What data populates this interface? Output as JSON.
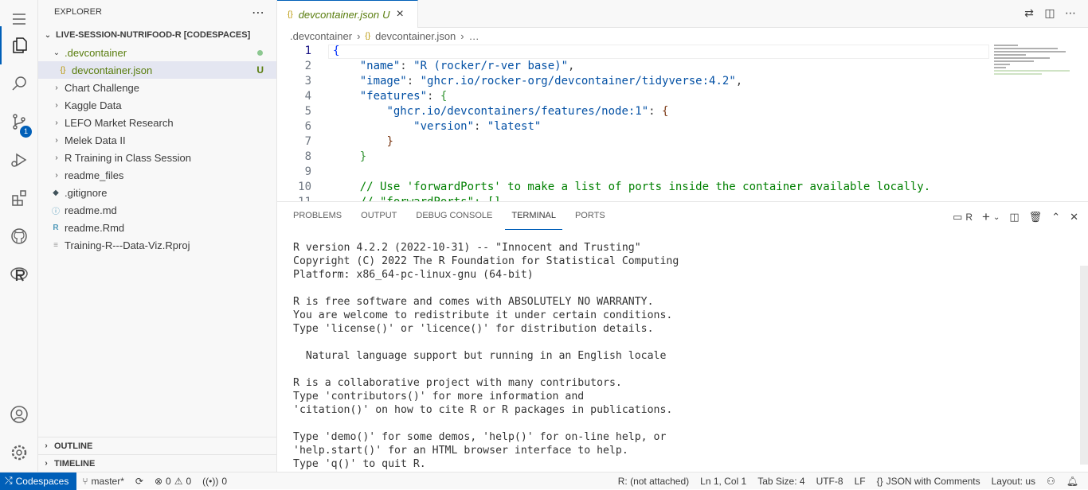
{
  "activity": {
    "scm_badge": "1"
  },
  "sidebar": {
    "title": "EXPLORER",
    "root": "LIVE-SESSION-NUTRIFOOD-R [CODESPACES]",
    "items": [
      {
        "label": ".devcontainer",
        "type": "folder-open",
        "color": "green"
      },
      {
        "label": "devcontainer.json",
        "type": "json",
        "decoration": "U"
      },
      {
        "label": "Chart Challenge",
        "type": "folder"
      },
      {
        "label": "Kaggle Data",
        "type": "folder"
      },
      {
        "label": "LEFO Market Research",
        "type": "folder"
      },
      {
        "label": "Melek Data II",
        "type": "folder"
      },
      {
        "label": "R Training in Class Session",
        "type": "folder"
      },
      {
        "label": "readme_files",
        "type": "folder"
      },
      {
        "label": ".gitignore",
        "type": "file"
      },
      {
        "label": "readme.md",
        "type": "file"
      },
      {
        "label": "readme.Rmd",
        "type": "file"
      },
      {
        "label": "Training-R---Data-Viz.Rproj",
        "type": "file"
      }
    ],
    "outline": "OUTLINE",
    "timeline": "TIMELINE"
  },
  "editor": {
    "tab_label": "devcontainer.json",
    "tab_decoration": "U",
    "breadcrumb": [
      ".devcontainer",
      "devcontainer.json",
      "…"
    ],
    "line_numbers": [
      "1",
      "2",
      "3",
      "4",
      "5",
      "6",
      "7",
      "8",
      "9",
      "10",
      "11"
    ]
  },
  "panel": {
    "tabs": [
      "PROBLEMS",
      "OUTPUT",
      "DEBUG CONSOLE",
      "TERMINAL",
      "PORTS"
    ],
    "active_tab": "TERMINAL",
    "terminal_name": "R",
    "terminal_lines": [
      "R version 4.2.2 (2022-10-31) -- \"Innocent and Trusting\"",
      "Copyright (C) 2022 The R Foundation for Statistical Computing",
      "Platform: x86_64-pc-linux-gnu (64-bit)",
      "",
      "R is free software and comes with ABSOLUTELY NO WARRANTY.",
      "You are welcome to redistribute it under certain conditions.",
      "Type 'license()' or 'licence()' for distribution details.",
      "",
      "  Natural language support but running in an English locale",
      "",
      "R is a collaborative project with many contributors.",
      "Type 'contributors()' for more information and",
      "'citation()' on how to cite R or R packages in publications.",
      "",
      "Type 'demo()' for some demos, 'help()' for on-line help, or",
      "'help.start()' for an HTML browser interface to help.",
      "Type 'q()' to quit R."
    ]
  },
  "status": {
    "remote": "Codespaces",
    "branch": "master*",
    "errors": "0",
    "warnings": "0",
    "ports": "0",
    "r_status": "R: (not attached)",
    "position": "Ln 1, Col 1",
    "tab_size": "Tab Size: 4",
    "encoding": "UTF-8",
    "eol": "LF",
    "language": "JSON with Comments",
    "layout": "Layout: us"
  },
  "colors": {
    "accent": "#005fb8",
    "untracked": "#587c0c"
  }
}
